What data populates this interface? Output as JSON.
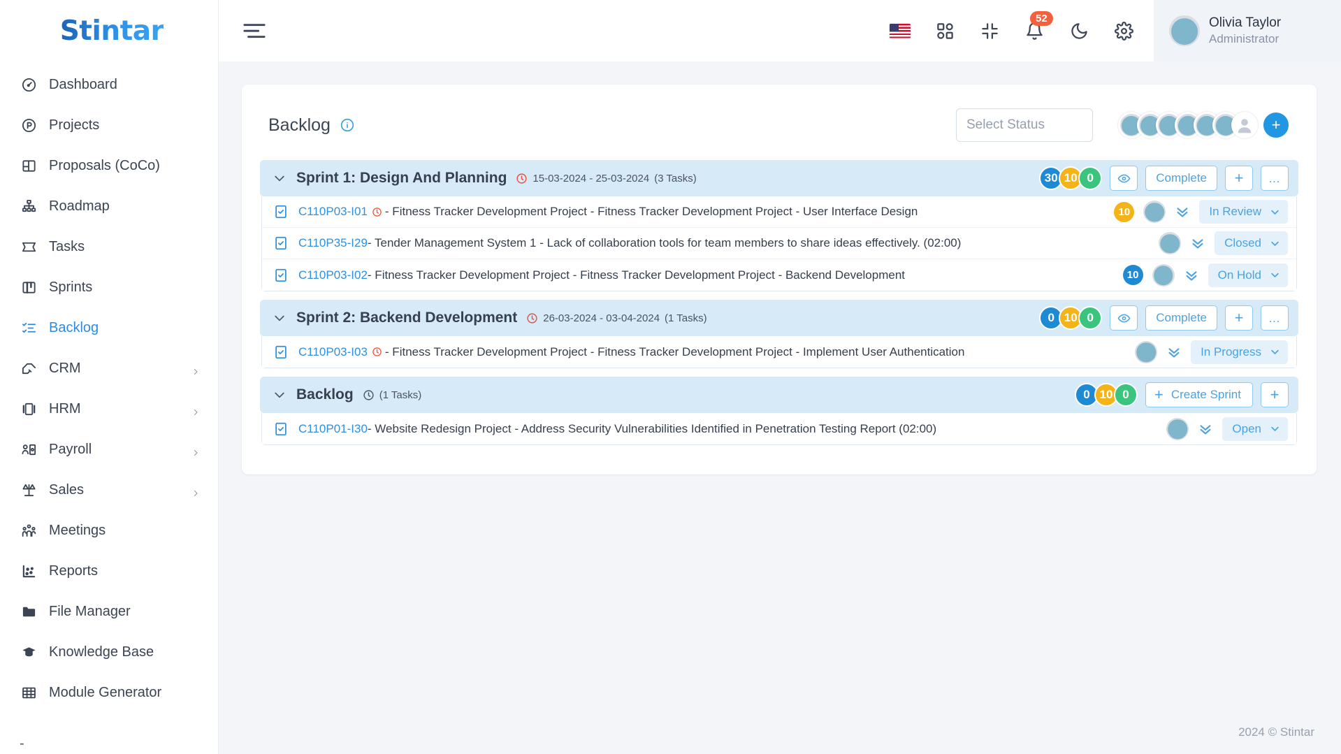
{
  "brand": {
    "name": "Stintar"
  },
  "sidebar": {
    "items": [
      {
        "label": "Dashboard",
        "icon": "gauge-icon",
        "expandable": false,
        "active": false
      },
      {
        "label": "Projects",
        "icon": "project-circle-icon",
        "expandable": false,
        "active": false
      },
      {
        "label": "Proposals (CoCo)",
        "icon": "layout-icon",
        "expandable": false,
        "active": false
      },
      {
        "label": "Roadmap",
        "icon": "hierarchy-icon",
        "expandable": false,
        "active": false
      },
      {
        "label": "Tasks",
        "icon": "ticket-icon",
        "expandable": false,
        "active": false
      },
      {
        "label": "Sprints",
        "icon": "board-icon",
        "expandable": false,
        "active": false
      },
      {
        "label": "Backlog",
        "icon": "checklist-icon",
        "expandable": false,
        "active": true
      },
      {
        "label": "CRM",
        "icon": "handshake-icon",
        "expandable": true,
        "active": false
      },
      {
        "label": "HRM",
        "icon": "id-card-icon",
        "expandable": true,
        "active": false
      },
      {
        "label": "Payroll",
        "icon": "money-person-icon",
        "expandable": true,
        "active": false
      },
      {
        "label": "Sales",
        "icon": "scales-icon",
        "expandable": true,
        "active": false
      },
      {
        "label": "Meetings",
        "icon": "people-icon",
        "expandable": false,
        "active": false
      },
      {
        "label": "Reports",
        "icon": "scatter-chart-icon",
        "expandable": false,
        "active": false
      },
      {
        "label": "File Manager",
        "icon": "folder-icon",
        "expandable": false,
        "active": false
      },
      {
        "label": "Knowledge Base",
        "icon": "graduation-cap-icon",
        "expandable": false,
        "active": false
      },
      {
        "label": "Module Generator",
        "icon": "grid-table-icon",
        "expandable": false,
        "active": false
      }
    ],
    "trailing_dash": "-"
  },
  "topbar": {
    "menu_toggle": "hamburger-icon",
    "language_flag": "us-flag-icon",
    "apps": "apps-grid-icon",
    "fullscreen": "collapse-screen-icon",
    "notifications": {
      "icon": "bell-icon",
      "count": "52"
    },
    "dark_mode": "moon-icon",
    "settings": "gear-icon",
    "user": {
      "name": "Olivia Taylor",
      "role": "Administrator"
    }
  },
  "page": {
    "title": "Backlog",
    "info_icon": "info-icon",
    "status_filter_placeholder": "Select Status",
    "avatar_count": 6,
    "add_member_label": "+"
  },
  "groups": [
    {
      "name": "Sprint 1: Design And Planning",
      "dates": "15-03-2024 - 25-03-2024",
      "task_count_label": "(3 Tasks)",
      "clock_color": "red",
      "pills": [
        {
          "value": "30",
          "color": "blue"
        },
        {
          "value": "10",
          "color": "amber"
        },
        {
          "value": "0",
          "color": "green"
        }
      ],
      "actions": [
        {
          "label": "",
          "icon": "eye-icon",
          "type": "icon"
        },
        {
          "label": "Complete",
          "icon": "",
          "type": "text"
        },
        {
          "label": "+",
          "icon": "plus-icon",
          "type": "icon"
        },
        {
          "label": "…",
          "icon": "ellipsis-icon",
          "type": "icon"
        }
      ],
      "tasks": [
        {
          "key": "C110P03-I01",
          "has_clock": true,
          "text": " - Fitness Tracker Development Project - Fitness Tracker Development Project - User Interface Design",
          "pill": {
            "value": "10",
            "color": "amber"
          },
          "status": "In Review"
        },
        {
          "key": "C110P35-I29",
          "has_clock": false,
          "text": " - Tender Management System 1 - Lack of collaboration tools for team members to share ideas effectively. (02:00)",
          "pill": null,
          "status": "Closed"
        },
        {
          "key": "C110P03-I02",
          "has_clock": false,
          "text": " - Fitness Tracker Development Project - Fitness Tracker Development Project - Backend Development",
          "pill": {
            "value": "10",
            "color": "blue"
          },
          "status": "On Hold"
        }
      ]
    },
    {
      "name": "Sprint 2: Backend Development",
      "dates": "26-03-2024 - 03-04-2024",
      "task_count_label": "(1 Tasks)",
      "clock_color": "red",
      "pills": [
        {
          "value": "0",
          "color": "blue"
        },
        {
          "value": "10",
          "color": "amber"
        },
        {
          "value": "0",
          "color": "green"
        }
      ],
      "actions": [
        {
          "label": "",
          "icon": "eye-icon",
          "type": "icon"
        },
        {
          "label": "Complete",
          "icon": "",
          "type": "text"
        },
        {
          "label": "+",
          "icon": "plus-icon",
          "type": "icon"
        },
        {
          "label": "…",
          "icon": "ellipsis-icon",
          "type": "icon"
        }
      ],
      "tasks": [
        {
          "key": "C110P03-I03",
          "has_clock": true,
          "text": " - Fitness Tracker Development Project - Fitness Tracker Development Project - Implement User Authentication",
          "pill": null,
          "status": "In Progress"
        }
      ]
    },
    {
      "name": "Backlog",
      "dates": "",
      "task_count_label": "(1 Tasks)",
      "clock_color": "grey",
      "pills": [
        {
          "value": "0",
          "color": "blue"
        },
        {
          "value": "10",
          "color": "amber"
        },
        {
          "value": "0",
          "color": "green"
        }
      ],
      "actions": [
        {
          "label": "Create Sprint",
          "icon": "plus-icon",
          "type": "create"
        },
        {
          "label": "+",
          "icon": "plus-icon",
          "type": "icon"
        }
      ],
      "tasks": [
        {
          "key": "C110P01-I30",
          "has_clock": false,
          "text": " - Website Redesign Project - Address Security Vulnerabilities Identified in Penetration Testing Report (02:00)",
          "pill": null,
          "status": "Open"
        }
      ]
    }
  ],
  "footer": {
    "copyright": "2024 © Stintar"
  },
  "colors": {
    "accent": "#2f90df",
    "sprint_header_bg": "#d6eaf8",
    "pill_blue": "#1f8ad4",
    "pill_amber": "#f4b316",
    "pill_green": "#3ac47d",
    "badge_red": "#f2603e"
  }
}
